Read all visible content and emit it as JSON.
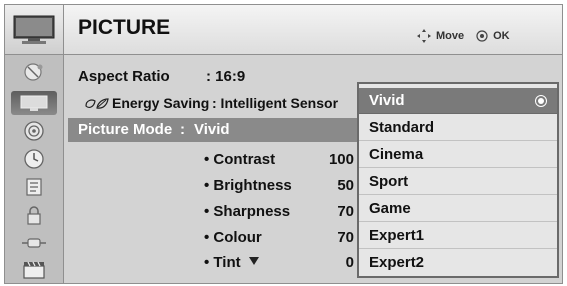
{
  "header": {
    "title": "PICTURE",
    "move_label": "Move",
    "ok_label": "OK"
  },
  "settings": {
    "aspect_ratio_label": "Aspect Ratio",
    "aspect_ratio_value": ": 16:9",
    "energy_saving_label": "Energy Saving",
    "energy_saving_value": ": Intelligent Sensor",
    "picture_mode_label": "Picture Mode",
    "picture_mode_sep": ":",
    "picture_mode_value": "Vivid"
  },
  "adjustments": [
    {
      "label": "• Contrast",
      "value": "100"
    },
    {
      "label": "• Brightness",
      "value": "50"
    },
    {
      "label": "• Sharpness",
      "value": "70"
    },
    {
      "label": "• Colour",
      "value": "70"
    },
    {
      "label": "• Tint",
      "value": "0"
    }
  ],
  "dropdown": {
    "selected": "Vivid",
    "options": [
      "Vivid",
      "Standard",
      "Cinema",
      "Sport",
      "Game",
      "Expert1",
      "Expert2"
    ]
  },
  "sidebar": {
    "items": [
      {
        "icon": "tv-icon"
      },
      {
        "icon": "picture-icon"
      },
      {
        "icon": "audio-icon"
      },
      {
        "icon": "time-icon"
      },
      {
        "icon": "option-icon"
      },
      {
        "icon": "lock-icon"
      },
      {
        "icon": "input-icon"
      },
      {
        "icon": "usb-icon"
      }
    ]
  },
  "colors": {
    "highlight": "#8a8a8a",
    "dropdown_selected": "#7a7a7a",
    "panel": "#d3d3d3"
  }
}
